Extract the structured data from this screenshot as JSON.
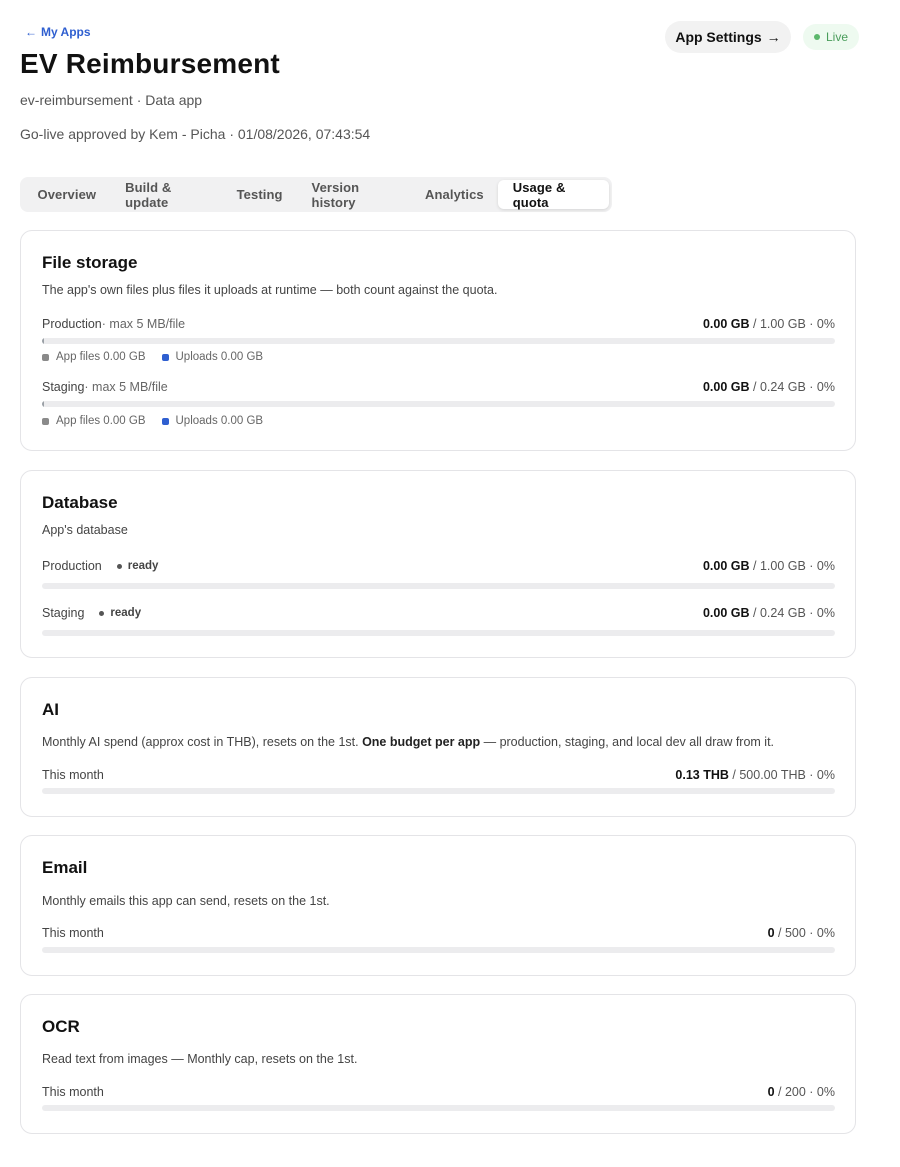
{
  "header": {
    "back_label": "My Apps",
    "back_arrow": "←",
    "title": "EV Reimbursement",
    "subtitle": "ev-reimbursement · Data app",
    "approval": "Go-live approved by Kem - Picha · 01/08/2026, 07:43:54",
    "settings_label": "App Settings",
    "settings_arrow": "→",
    "status_badge": "Live"
  },
  "tabs": [
    {
      "label": "Overview",
      "active": false
    },
    {
      "label": "Build & update",
      "active": false
    },
    {
      "label": "Testing",
      "active": false
    },
    {
      "label": "Version history",
      "active": false
    },
    {
      "label": "Analytics",
      "active": false
    },
    {
      "label": "Usage & quota",
      "active": true
    }
  ],
  "colors": {
    "link": "#2f5fd0",
    "live_text": "#4a9d5b",
    "live_dot": "#5cb86c",
    "app_files_legend": "#8a8a8a",
    "uploads_legend": "#2f5fd0"
  },
  "file_storage": {
    "title": "File storage",
    "desc": "The app's own files plus files it uploads at runtime — both count against the quota.",
    "production": {
      "label": "Production",
      "limit": " · max 5 MB/file",
      "used": "0.00 GB",
      "rest": " / 1.00 GB · 0%",
      "percent": 0.3,
      "app_files": "App files 0.00 GB",
      "uploads": "Uploads 0.00 GB"
    },
    "staging": {
      "label": "Staging",
      "limit": " · max 5 MB/file",
      "used": "0.00 GB",
      "rest": " / 0.24 GB · 0%",
      "percent": 0.3,
      "app_files": "App files 0.00 GB",
      "uploads": "Uploads 0.00 GB"
    }
  },
  "database": {
    "title": "Database",
    "desc": "App's database",
    "production": {
      "label": "Production",
      "status": "ready",
      "used": "0.00 GB",
      "rest": " / 1.00 GB · 0%",
      "percent": 0
    },
    "staging": {
      "label": "Staging",
      "status": "ready",
      "used": "0.00 GB",
      "rest": " / 0.24 GB · 0%",
      "percent": 0
    }
  },
  "ai": {
    "title": "AI",
    "desc_pre": "Monthly AI spend (approx cost in THB), resets on the 1st. ",
    "desc_bold": "One budget per app",
    "desc_post": " — production, staging, and local dev all draw from it.",
    "row_label": "This month",
    "used": "0.13 THB",
    "rest": " / 500.00 THB · 0%",
    "percent": 0
  },
  "email": {
    "title": "Email",
    "desc": "Monthly emails this app can send, resets on the 1st.",
    "row_label": "This month",
    "used": "0",
    "rest": " / 500 · 0%",
    "percent": 0
  },
  "ocr": {
    "title": "OCR",
    "desc": "Read text from images — Monthly cap, resets on the 1st.",
    "row_label": "This month",
    "used": "0",
    "rest": " / 200 · 0%",
    "percent": 0
  }
}
